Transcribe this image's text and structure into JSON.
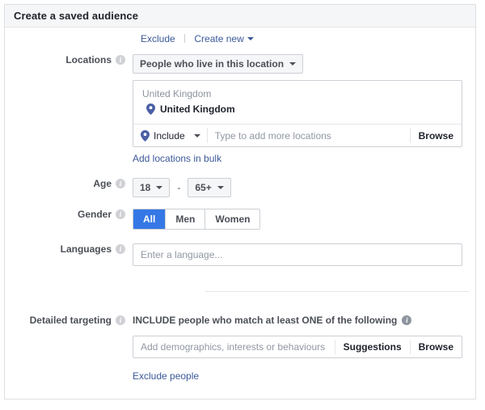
{
  "panel": {
    "title": "Create a saved audience"
  },
  "top_links": {
    "exclude": "Exclude",
    "create_new": "Create new"
  },
  "locations": {
    "label": "Locations",
    "type_dropdown": "People who live in this location",
    "group_header": "United Kingdom",
    "selected_location": "United Kingdom",
    "include_dropdown": "Include",
    "input_placeholder": "Type to add more locations",
    "browse": "Browse",
    "bulk_link": "Add locations in bulk",
    "pin_icon": "map-pin-icon",
    "info_icon": "info-icon"
  },
  "age": {
    "label": "Age",
    "min": "18",
    "max": "65+",
    "separator": "-"
  },
  "gender": {
    "label": "Gender",
    "options": [
      {
        "label": "All",
        "selected": true
      },
      {
        "label": "Men",
        "selected": false
      },
      {
        "label": "Women",
        "selected": false
      }
    ]
  },
  "languages": {
    "label": "Languages",
    "placeholder": "Enter a language..."
  },
  "detailed_targeting": {
    "label": "Detailed targeting",
    "heading": "INCLUDE people who match at least ONE of the following",
    "placeholder": "Add demographics, interests or behaviours",
    "suggestions": "Suggestions",
    "browse": "Browse",
    "exclude_link": "Exclude people"
  },
  "colors": {
    "accent_blue": "#3578e5",
    "link_blue": "#3b5998",
    "pin_blue": "#4a5fa5",
    "border": "#ccd0d5",
    "header_bg": "#f5f6f7"
  }
}
